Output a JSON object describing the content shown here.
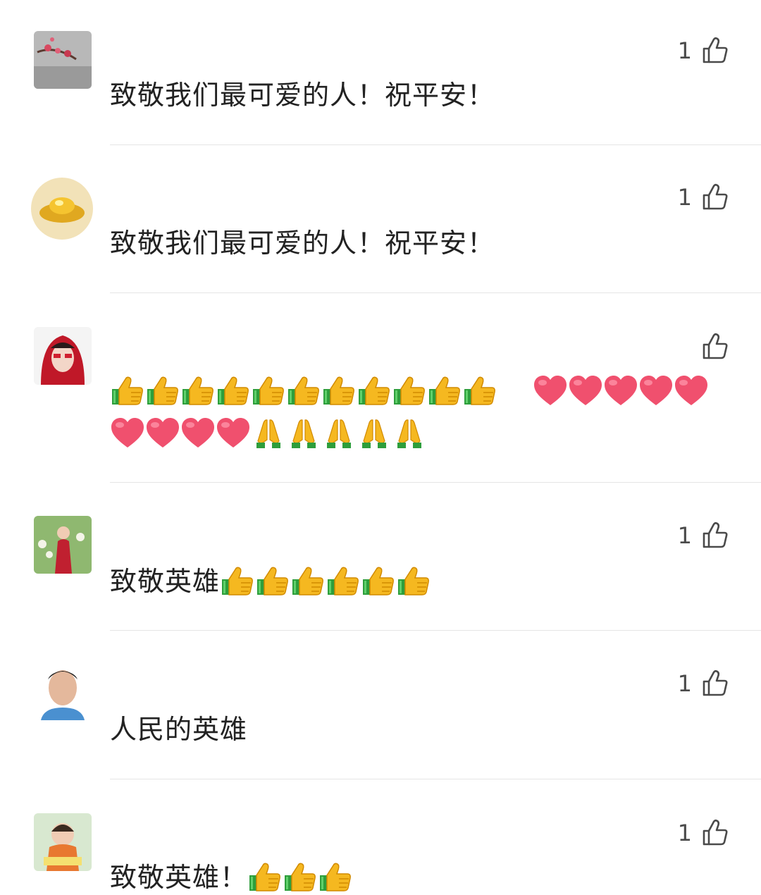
{
  "comments": [
    {
      "avatar": "plum-blossom-avatar",
      "text": "致敬我们最可爱的人！祝平安！",
      "likes": "1"
    },
    {
      "avatar": "gold-ingot-avatar",
      "text": "致敬我们最可爱的人！祝平安！",
      "likes": "1"
    },
    {
      "avatar": "red-hood-girl-avatar",
      "text": "",
      "likes": "",
      "emoji_line1": [
        "thumbs-up",
        "thumbs-up",
        "thumbs-up",
        "thumbs-up",
        "thumbs-up",
        "thumbs-up",
        "thumbs-up",
        "thumbs-up",
        "thumbs-up",
        "thumbs-up",
        "thumbs-up",
        "heart",
        "heart",
        "heart",
        "heart",
        "heart"
      ],
      "emoji_line2": [
        "heart",
        "heart",
        "heart",
        "heart",
        "pray",
        "pray",
        "pray",
        "pray",
        "pray"
      ]
    },
    {
      "avatar": "woman-flowers-avatar",
      "text": "致敬英雄",
      "likes": "1",
      "emoji": [
        "thumbs-up",
        "thumbs-up",
        "thumbs-up",
        "thumbs-up",
        "thumbs-up",
        "thumbs-up"
      ]
    },
    {
      "avatar": "man-portrait-avatar",
      "text": "人民的英雄",
      "likes": "1"
    },
    {
      "avatar": "child-reading-avatar",
      "text": "致敬英雄！",
      "likes": "1",
      "emoji": [
        "thumbs-up",
        "thumbs-up",
        "thumbs-up"
      ]
    }
  ],
  "colors": {
    "text": "#222222",
    "like": "#4a4a4a",
    "divider": "#e5e5e5",
    "heart": "#f0506e",
    "thumb": "#f5b820"
  }
}
